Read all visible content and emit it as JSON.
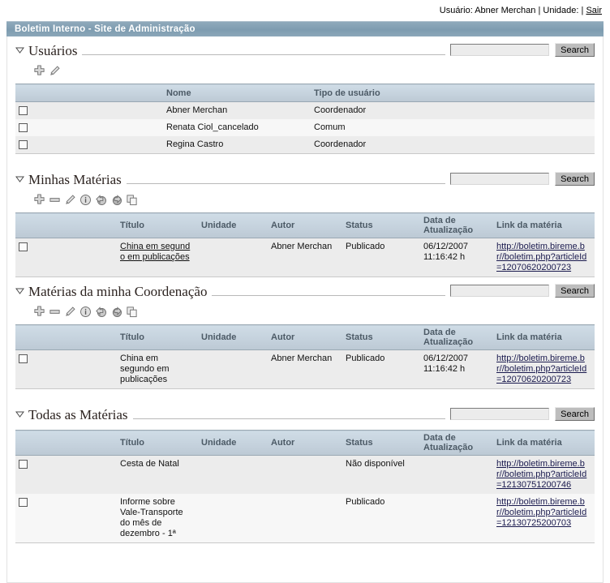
{
  "topbar": {
    "user_label": "Usuário: Abner Merchan",
    "sep1": " | ",
    "unit_label": "Unidade:",
    "sep2": " | ",
    "logout": "Sair"
  },
  "titlebar": {
    "title": "Boletim Interno - Site de Administração",
    "bg": "#7e9cb0",
    "fg": "#ffffff"
  },
  "common": {
    "search_button": "Search",
    "search_placeholder": "",
    "search_value": ""
  },
  "sections": {
    "usuarios": {
      "title": "Usuários",
      "toolbar": [
        "add-icon",
        "edit-pencil-icon"
      ],
      "columns": [
        "Nome",
        "Tipo de usuário"
      ],
      "rows": [
        {
          "nome": "Abner Merchan",
          "tipo": "Coordenador"
        },
        {
          "nome": "Renata Ciol_cancelado",
          "tipo": "Comum"
        },
        {
          "nome": "Regina Castro",
          "tipo": "Coordenador"
        }
      ]
    },
    "minhas_materias": {
      "title": "Minhas Matérias",
      "toolbar": [
        "add-icon",
        "remove-icon",
        "edit-pencil-icon",
        "info-icon",
        "publish-up-icon",
        "unpublish-down-icon",
        "copy-icon"
      ],
      "columns": [
        "Título",
        "Unidade",
        "Autor",
        "Status",
        "Data de Atualização",
        "Link da matéria"
      ],
      "rows": [
        {
          "titulo": "China em segundo em publicações",
          "titulo_is_link": true,
          "unidade": "",
          "autor": "Abner Merchan",
          "status": "Publicado",
          "data": "06/12/2007 11:16:42 h",
          "link": "http://boletim.bireme.br//boletim.php?articleId=12070620200723"
        }
      ]
    },
    "coordenacao": {
      "title": "Matérias da minha Coordenação",
      "toolbar": [
        "add-icon",
        "remove-icon",
        "edit-pencil-icon",
        "info-icon",
        "publish-up-icon",
        "unpublish-down-icon",
        "copy-icon"
      ],
      "columns": [
        "Título",
        "Unidade",
        "Autor",
        "Status",
        "Data de Atualização",
        "Link da matéria"
      ],
      "rows": [
        {
          "titulo": "China em segundo em publicações",
          "titulo_is_link": false,
          "unidade": "",
          "autor": "Abner Merchan",
          "status": "Publicado",
          "data": "06/12/2007 11:16:42 h",
          "link": "http://boletim.bireme.br//boletim.php?articleId=12070620200723"
        }
      ]
    },
    "todas": {
      "title": "Todas as Matérias",
      "toolbar": [],
      "columns": [
        "Título",
        "Unidade",
        "Autor",
        "Status",
        "Data de Atualização",
        "Link da matéria"
      ],
      "rows": [
        {
          "titulo": "Cesta de Natal",
          "titulo_is_link": false,
          "unidade": "",
          "autor": "",
          "status": "Não disponível",
          "data": "",
          "link": "http://boletim.bireme.br//boletim.php?articleId=12130751200746"
        },
        {
          "titulo": "Informe sobre Vale-Transporte do mês de dezembro - 1ª",
          "titulo_is_link": false,
          "unidade": "",
          "autor": "",
          "status": "Publicado",
          "data": "",
          "link": "http://boletim.bireme.br//boletim.php?articleId=12130725200703"
        }
      ]
    }
  },
  "column_header_labels": {
    "data_line1": "Data de",
    "data_line2": "Atualização"
  }
}
